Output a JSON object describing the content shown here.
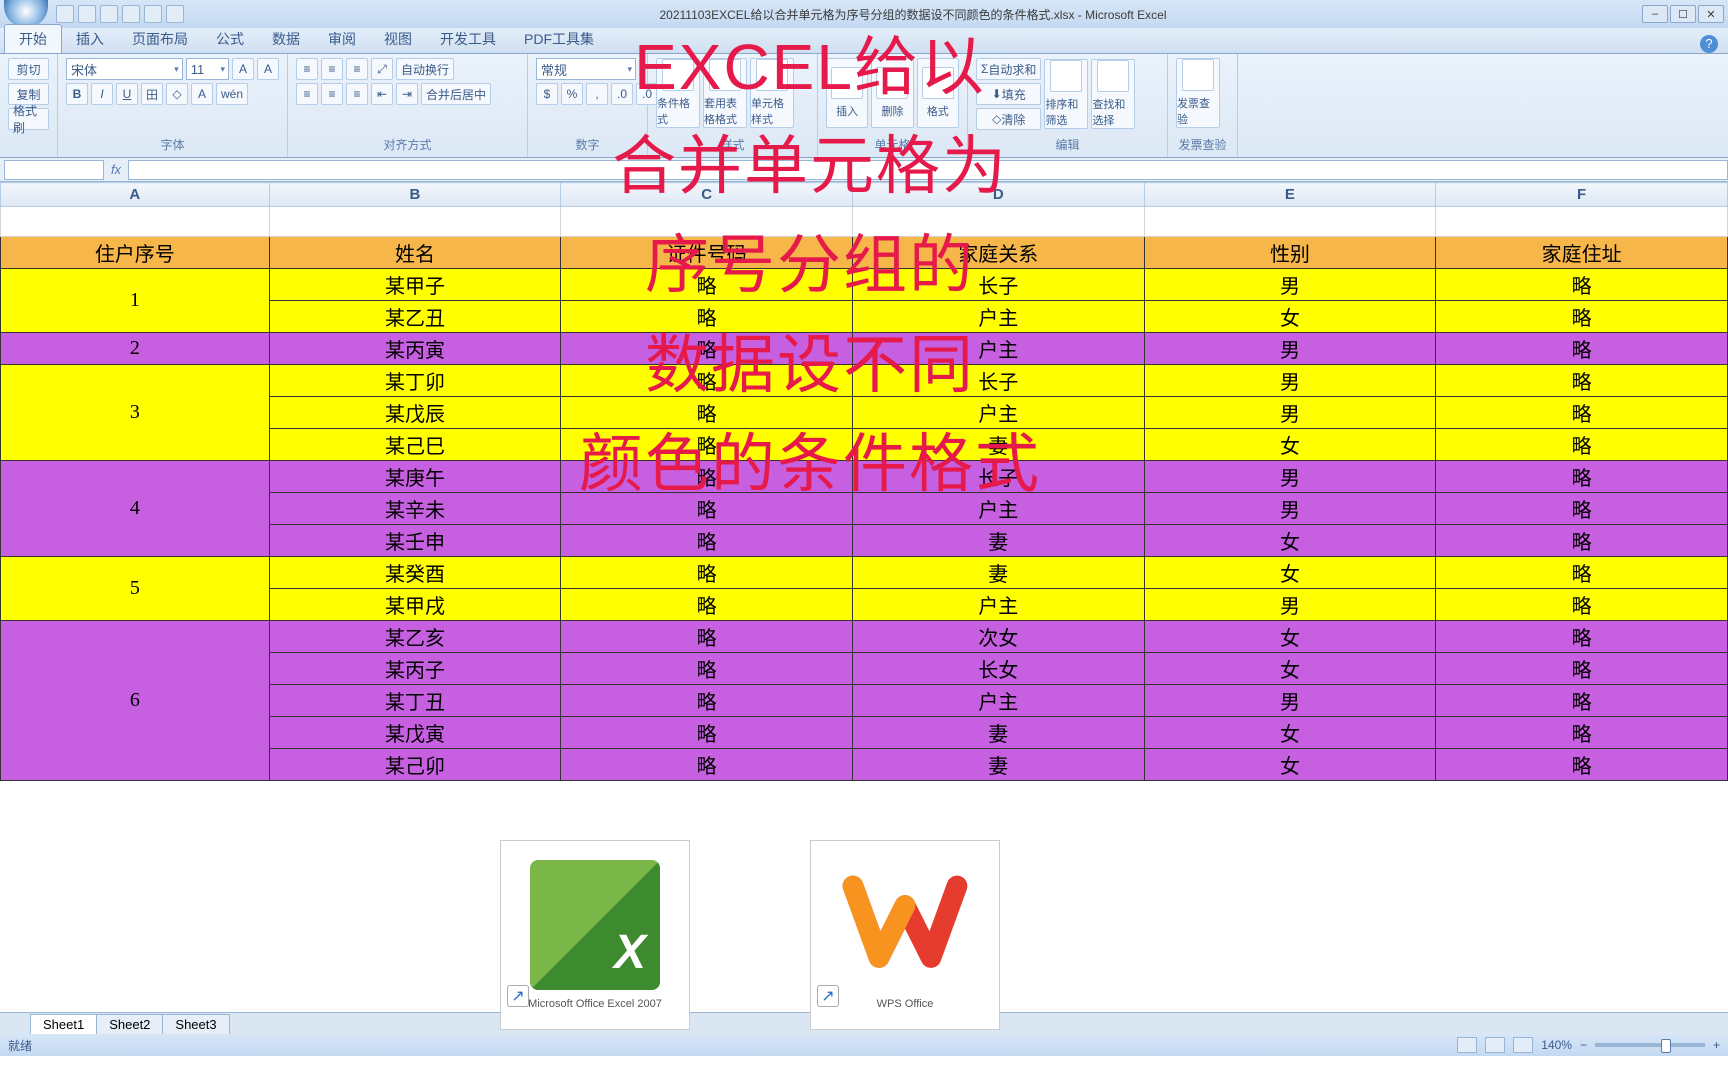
{
  "window": {
    "title": "20211103EXCEL给以合并单元格为序号分组的数据设不同颜色的条件格式.xlsx - Microsoft Excel"
  },
  "tabs": [
    "开始",
    "插入",
    "页面布局",
    "公式",
    "数据",
    "审阅",
    "视图",
    "开发工具",
    "PDF工具集"
  ],
  "active_tab": 0,
  "ribbon": {
    "clipboard": {
      "cut": "剪切",
      "copy": "复制",
      "paint": "格式刷",
      "label": ""
    },
    "font": {
      "name": "宋体",
      "size": "11",
      "label": "字体"
    },
    "alignment": {
      "wrap": "自动换行",
      "merge": "合并后居中",
      "label": "对齐方式"
    },
    "number": {
      "format": "常规",
      "label": "数字"
    },
    "styles": {
      "cond": "条件格式",
      "table": "套用表格格式",
      "cell": "单元格样式",
      "label": "样式"
    },
    "cells": {
      "insert": "插入",
      "delete": "删除",
      "format": "格式",
      "label": "单元格"
    },
    "editing": {
      "sum": "自动求和",
      "fill": "填充",
      "clear": "清除",
      "sort": "排序和筛选",
      "find": "查找和选择",
      "label": "编辑"
    },
    "invoice": {
      "check": "发票查验",
      "label": "发票查验"
    }
  },
  "name_box": "",
  "columns": [
    "A",
    "B",
    "C",
    "D",
    "E",
    "F"
  ],
  "headers": [
    "住户序号",
    "姓名",
    "证件号码",
    "家庭关系",
    "性别",
    "家庭住址"
  ],
  "rows": [
    {
      "seq": "1",
      "span": 2,
      "color": "yellow",
      "people": [
        [
          "某甲子",
          "略",
          "长子",
          "男",
          "略"
        ],
        [
          "某乙丑",
          "略",
          "户主",
          "女",
          "略"
        ]
      ]
    },
    {
      "seq": "2",
      "span": 1,
      "color": "purple",
      "people": [
        [
          "某丙寅",
          "略",
          "户主",
          "男",
          "略"
        ]
      ]
    },
    {
      "seq": "3",
      "span": 3,
      "color": "yellow",
      "people": [
        [
          "某丁卯",
          "略",
          "长子",
          "男",
          "略"
        ],
        [
          "某戊辰",
          "略",
          "户主",
          "男",
          "略"
        ],
        [
          "某己巳",
          "略",
          "妻",
          "女",
          "略"
        ]
      ]
    },
    {
      "seq": "4",
      "span": 3,
      "color": "purple",
      "people": [
        [
          "某庚午",
          "略",
          "长子",
          "男",
          "略"
        ],
        [
          "某辛未",
          "略",
          "户主",
          "男",
          "略"
        ],
        [
          "某壬申",
          "略",
          "妻",
          "女",
          "略"
        ]
      ]
    },
    {
      "seq": "5",
      "span": 2,
      "color": "yellow",
      "people": [
        [
          "某癸酉",
          "略",
          "妻",
          "女",
          "略"
        ],
        [
          "某甲戌",
          "略",
          "户主",
          "男",
          "略"
        ]
      ]
    },
    {
      "seq": "6",
      "span": 5,
      "color": "purple",
      "people": [
        [
          "某乙亥",
          "略",
          "次女",
          "女",
          "略"
        ],
        [
          "某丙子",
          "略",
          "长女",
          "女",
          "略"
        ],
        [
          "某丁丑",
          "略",
          "户主",
          "男",
          "略"
        ],
        [
          "某戊寅",
          "略",
          "妻",
          "女",
          "略"
        ],
        [
          "某己卯",
          "略",
          "妻",
          "女",
          "略"
        ]
      ]
    }
  ],
  "sheets": [
    "Sheet1",
    "Sheet2",
    "Sheet3"
  ],
  "status": {
    "ready": "就绪",
    "zoom": "140%"
  },
  "overlay": {
    "line1": "EXCEL给以",
    "line2": "合并单元格为",
    "line3": "序号分组的",
    "line4": "数据设不同",
    "line5": "颜色的条件格式"
  },
  "icons": {
    "excel": "Microsoft Office Excel 2007",
    "wps": "WPS Office"
  }
}
